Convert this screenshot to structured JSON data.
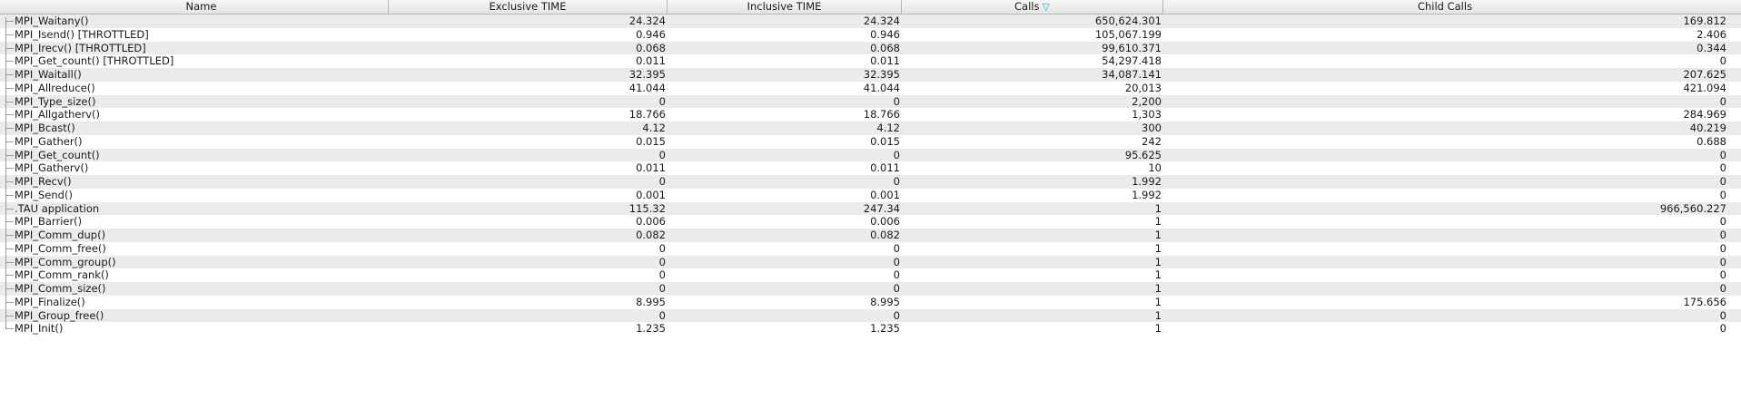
{
  "columns": {
    "name": "Name",
    "exclusive": "Exclusive TIME",
    "inclusive": "Inclusive TIME",
    "calls": "Calls",
    "child_calls": "Child Calls",
    "sort_icon": "sort-descending-icon",
    "sort_glyph": "▽"
  },
  "colors": {
    "row_alt": "#ebebeb",
    "sort_icon": "#2aa7c2"
  },
  "rows": [
    {
      "name": "MPI_Waitany()",
      "exclusive": "24.324",
      "inclusive": "24.324",
      "calls": "650,624.301",
      "child_calls": "169.812"
    },
    {
      "name": "MPI_Isend() [THROTTLED]",
      "exclusive": "0.946",
      "inclusive": "0.946",
      "calls": "105,067.199",
      "child_calls": "2.406"
    },
    {
      "name": "MPI_Irecv() [THROTTLED]",
      "exclusive": "0.068",
      "inclusive": "0.068",
      "calls": "99,610.371",
      "child_calls": "0.344"
    },
    {
      "name": "MPI_Get_count() [THROTTLED]",
      "exclusive": "0.011",
      "inclusive": "0.011",
      "calls": "54,297.418",
      "child_calls": "0"
    },
    {
      "name": "MPI_Waitall()",
      "exclusive": "32.395",
      "inclusive": "32.395",
      "calls": "34,087.141",
      "child_calls": "207.625"
    },
    {
      "name": "MPI_Allreduce()",
      "exclusive": "41.044",
      "inclusive": "41.044",
      "calls": "20,013",
      "child_calls": "421.094"
    },
    {
      "name": "MPI_Type_size()",
      "exclusive": "0",
      "inclusive": "0",
      "calls": "2,200",
      "child_calls": "0"
    },
    {
      "name": "MPI_Allgatherv()",
      "exclusive": "18.766",
      "inclusive": "18.766",
      "calls": "1,303",
      "child_calls": "284.969"
    },
    {
      "name": "MPI_Bcast()",
      "exclusive": "4.12",
      "inclusive": "4.12",
      "calls": "300",
      "child_calls": "40.219"
    },
    {
      "name": "MPI_Gather()",
      "exclusive": "0.015",
      "inclusive": "0.015",
      "calls": "242",
      "child_calls": "0.688"
    },
    {
      "name": "MPI_Get_count()",
      "exclusive": "0",
      "inclusive": "0",
      "calls": "95.625",
      "child_calls": "0"
    },
    {
      "name": "MPI_Gatherv()",
      "exclusive": "0.011",
      "inclusive": "0.011",
      "calls": "10",
      "child_calls": "0"
    },
    {
      "name": "MPI_Recv()",
      "exclusive": "0",
      "inclusive": "0",
      "calls": "1.992",
      "child_calls": "0"
    },
    {
      "name": "MPI_Send()",
      "exclusive": "0.001",
      "inclusive": "0.001",
      "calls": "1.992",
      "child_calls": "0"
    },
    {
      "name": ".TAU application",
      "exclusive": "115.32",
      "inclusive": "247.34",
      "calls": "1",
      "child_calls": "966,560.227"
    },
    {
      "name": "MPI_Barrier()",
      "exclusive": "0.006",
      "inclusive": "0.006",
      "calls": "1",
      "child_calls": "0"
    },
    {
      "name": "MPI_Comm_dup()",
      "exclusive": "0.082",
      "inclusive": "0.082",
      "calls": "1",
      "child_calls": "0"
    },
    {
      "name": "MPI_Comm_free()",
      "exclusive": "0",
      "inclusive": "0",
      "calls": "1",
      "child_calls": "0"
    },
    {
      "name": "MPI_Comm_group()",
      "exclusive": "0",
      "inclusive": "0",
      "calls": "1",
      "child_calls": "0"
    },
    {
      "name": "MPI_Comm_rank()",
      "exclusive": "0",
      "inclusive": "0",
      "calls": "1",
      "child_calls": "0"
    },
    {
      "name": "MPI_Comm_size()",
      "exclusive": "0",
      "inclusive": "0",
      "calls": "1",
      "child_calls": "0"
    },
    {
      "name": "MPI_Finalize()",
      "exclusive": "8.995",
      "inclusive": "8.995",
      "calls": "1",
      "child_calls": "175.656"
    },
    {
      "name": "MPI_Group_free()",
      "exclusive": "0",
      "inclusive": "0",
      "calls": "1",
      "child_calls": "0"
    },
    {
      "name": "MPI_Init()",
      "exclusive": "1.235",
      "inclusive": "1.235",
      "calls": "1",
      "child_calls": "0"
    }
  ]
}
